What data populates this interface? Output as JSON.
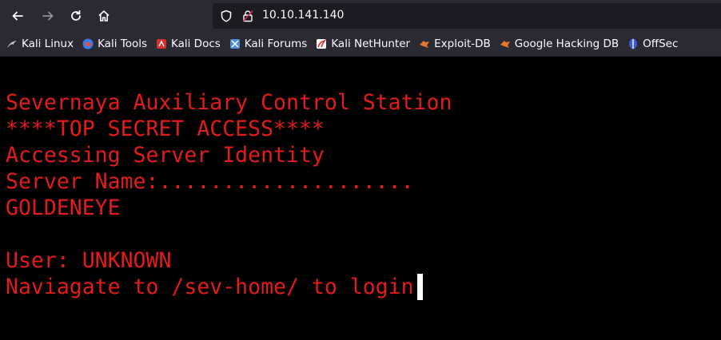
{
  "browser": {
    "url": "10.10.141.140",
    "icons": {
      "back": "arrow-left-icon",
      "forward": "arrow-right-icon",
      "reload": "reload-icon",
      "home": "home-icon",
      "shield": "shield-icon",
      "lock": "insecure-lock-icon"
    }
  },
  "bookmarks": [
    {
      "label": "Kali Linux",
      "icon": "kali-dragon-icon"
    },
    {
      "label": "Kali Tools",
      "icon": "kali-tools-icon"
    },
    {
      "label": "Kali Docs",
      "icon": "kali-docs-icon"
    },
    {
      "label": "Kali Forums",
      "icon": "kali-forums-icon"
    },
    {
      "label": "Kali NetHunter",
      "icon": "kali-nethunter-icon"
    },
    {
      "label": "Exploit-DB",
      "icon": "exploit-db-icon"
    },
    {
      "label": "Google Hacking DB",
      "icon": "ghdb-icon"
    },
    {
      "label": "OffSec",
      "icon": "offsec-icon"
    }
  ],
  "terminal": {
    "lines": [
      "Severnaya Auxiliary Control Station",
      "****TOP SECRET ACCESS****",
      "Accessing Server Identity",
      "Server Name:....................",
      "GOLDENEYE",
      "",
      "User: UNKNOWN",
      "Naviagate to /sev-home/ to login"
    ]
  },
  "colors": {
    "terminal_text": "#e21b1b",
    "terminal_bg": "#000000",
    "toolbar_bg": "#2b2a33",
    "urlbar_bg": "#1c1b22"
  }
}
